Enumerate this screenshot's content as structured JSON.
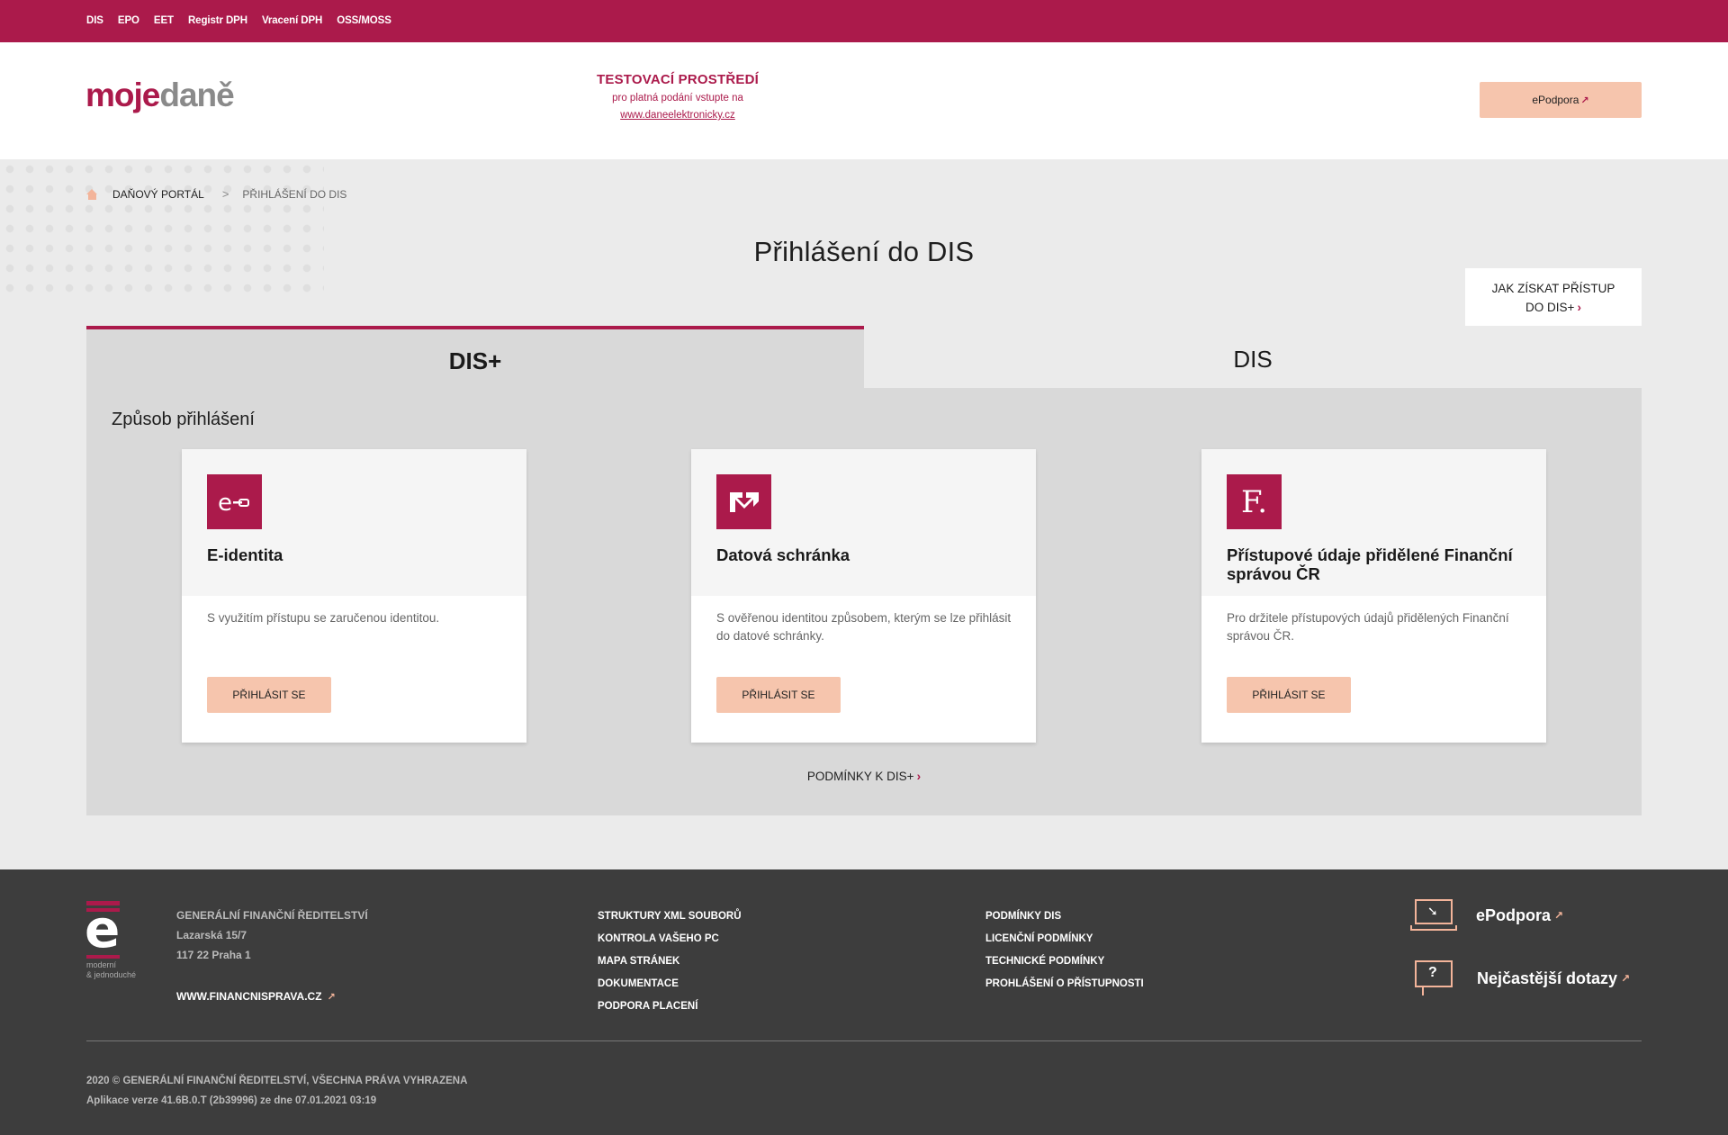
{
  "topnav": [
    "DIS",
    "EPO",
    "EET",
    "Registr DPH",
    "Vracení DPH",
    "OSS/MOSS"
  ],
  "header": {
    "logo_moje": "moje",
    "logo_dane": "daně",
    "test_title": "TESTOVACÍ PROSTŘEDÍ",
    "test_sub": "pro platná podání vstupte na",
    "test_link": "www.daneelektronicky.cz",
    "epodpora": "ePodpora"
  },
  "breadcrumb": {
    "item1": "DAŇOVÝ PORTÁL",
    "sep": ">",
    "item2": "PŘIHLÁŠENÍ DO DIS"
  },
  "page_title": "Přihlášení do DIS",
  "help_bubble": {
    "line1": "JAK ZÍSKAT PŘÍSTUP",
    "line2": "DO DIS+"
  },
  "tabs": {
    "active": "DIS+",
    "other": "DIS"
  },
  "panel": {
    "title": "Způsob přihlášení",
    "cards": [
      {
        "icon": "e-identity-icon",
        "title": "E-identita",
        "desc": "S využitím přístupu se zaručenou identitou.",
        "button": "PŘIHLÁSIT SE"
      },
      {
        "icon": "databox-icon",
        "title": "Datová schránka",
        "desc": "S ověřenou identitou způsobem, kterým se lze přihlásit do datové schránky.",
        "button": "PŘIHLÁSIT SE"
      },
      {
        "icon": "financni-sprava-icon",
        "icon_text": "F.",
        "title": "Přístupové údaje přidělené Finanční správou ČR",
        "desc": "Pro držitele přístupových údajů přidělených Finanční správou ČR.",
        "button": "PŘIHLÁSIT SE"
      }
    ],
    "conditions": "PODMÍNKY K DIS+"
  },
  "footer": {
    "logo_text1": "moderní",
    "logo_text2": "& jednoduché",
    "org": [
      "GENERÁLNÍ FINANČNÍ ŘEDITELSTVÍ",
      "Lazarská 15/7",
      "117 22 Praha 1"
    ],
    "web": "WWW.FINANCNISPRAVA.CZ",
    "col1": [
      "STRUKTURY XML SOUBORŮ",
      "KONTROLA VAŠEHO PC",
      "MAPA STRÁNEK",
      "DOKUMENTACE",
      "PODPORA PLACENÍ"
    ],
    "col2": [
      "PODMÍNKY DIS",
      "LICENČNÍ PODMÍNKY",
      "TECHNICKÉ PODMÍNKY",
      "PROHLÁŠENÍ O PŘÍSTUPNOSTI"
    ],
    "help1": "ePodpora",
    "help2": "Nejčastější dotazy",
    "copyright": "2020 © GENERÁLNÍ FINANČNÍ ŘEDITELSTVÍ, VŠECHNA PRÁVA VYHRAZENA",
    "version": "Aplikace verze 41.6B.0.T (2b39996) ze dne 07.01.2021 03:19"
  },
  "colors": {
    "brand": "#ab1a4b",
    "accent_button": "#f6c5ad",
    "footer_bg": "#3d3d3d"
  }
}
